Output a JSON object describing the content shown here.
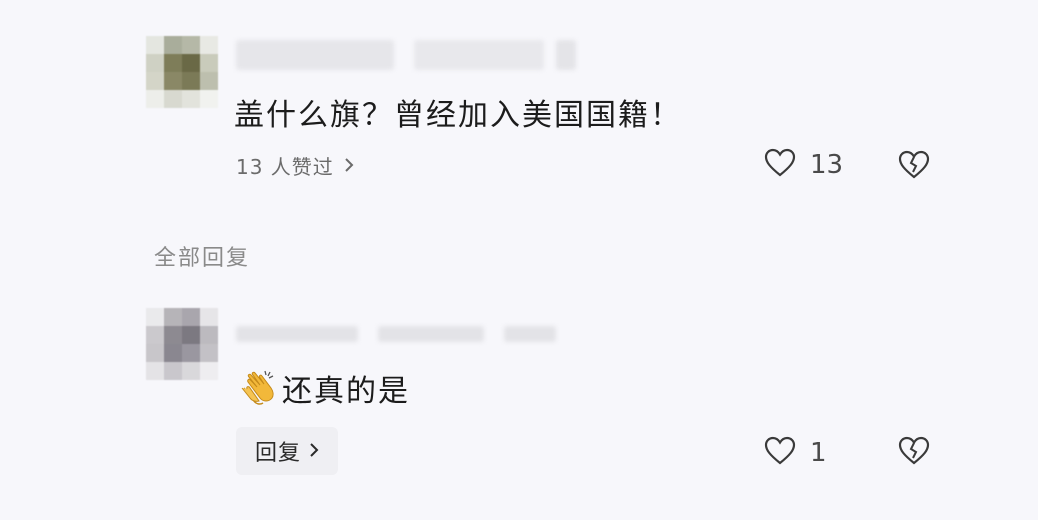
{
  "comment1": {
    "text": "盖什么旗？曾经加入美国国籍！",
    "liked_by": "13 人赞过",
    "like_count": "13"
  },
  "replies_section": {
    "label": "全部回复"
  },
  "reply1": {
    "emoji": "👏",
    "text": "还真的是",
    "reply_button_label": "回复",
    "like_count": "1"
  },
  "icons": {
    "chevron": "chevron-right-icon",
    "like": "heart-icon",
    "dislike": "broken-heart-icon"
  }
}
